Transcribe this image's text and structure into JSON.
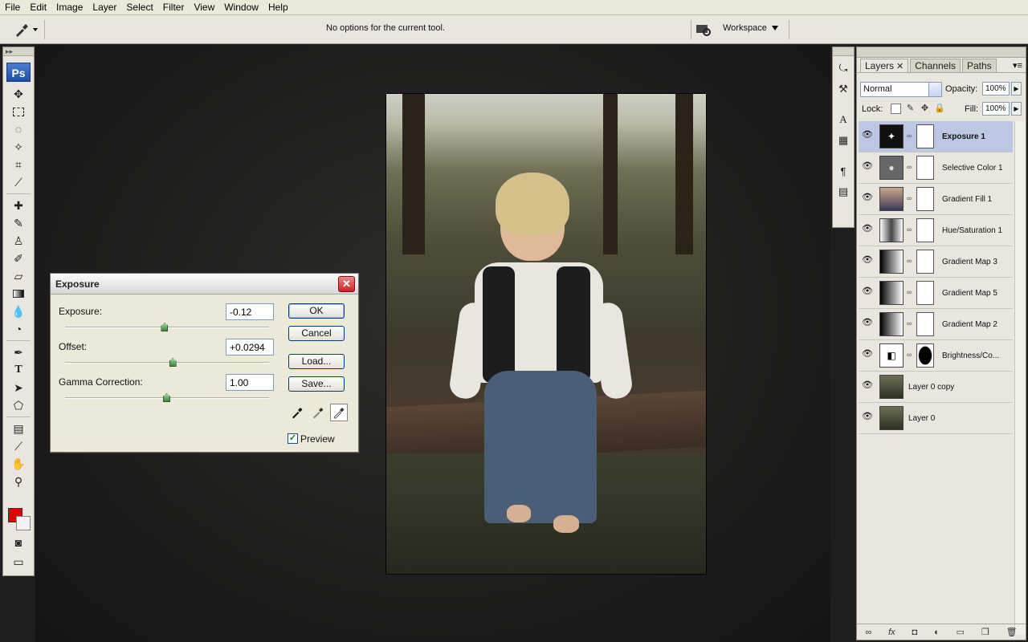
{
  "menu": [
    "File",
    "Edit",
    "Image",
    "Layer",
    "Select",
    "Filter",
    "View",
    "Window",
    "Help"
  ],
  "options_bar": {
    "message": "No options for the current tool.",
    "workspace_label": "Workspace"
  },
  "toolbox": {
    "logo": "Ps",
    "tools": [
      "move-tool",
      "marquee-tool",
      "lasso-tool",
      "magic-wand-tool",
      "crop-tool",
      "slice-tool",
      "healing-brush-tool",
      "brush-tool",
      "clone-stamp-tool",
      "history-brush-tool",
      "eraser-tool",
      "gradient-tool",
      "blur-tool",
      "dodge-tool",
      "pen-tool",
      "type-tool",
      "path-selection-tool",
      "shape-tool",
      "notes-tool",
      "eyedropper-tool",
      "hand-tool",
      "zoom-tool"
    ],
    "foreground_color": "#e00000",
    "background_color": "#f2f2f2"
  },
  "exposure_dialog": {
    "title": "Exposure",
    "exposure_label": "Exposure:",
    "exposure_value": "-0.12",
    "exposure_slider_level": 0.49,
    "offset_label": "Offset:",
    "offset_value": "+0.0294",
    "offset_slider_level": 0.53,
    "gamma_label": "Gamma Correction:",
    "gamma_value": "1.00",
    "gamma_slider_level": 0.5,
    "ok_label": "OK",
    "cancel_label": "Cancel",
    "load_label": "Load...",
    "save_label": "Save...",
    "preview_label": "Preview",
    "preview_checked": true
  },
  "layers_panel": {
    "tabs": [
      "Layers",
      "Channels",
      "Paths"
    ],
    "blend_mode": "Normal",
    "opacity_label": "Opacity:",
    "opacity_value": "100%",
    "lock_label": "Lock:",
    "fill_label": "Fill:",
    "fill_value": "100%",
    "layers": [
      {
        "name": "Exposure 1",
        "selected": true,
        "thumb": "exposure-icon"
      },
      {
        "name": "Selective Color 1",
        "selected": false,
        "thumb": "selective-color-icon"
      },
      {
        "name": "Gradient Fill 1",
        "selected": false,
        "thumb": "gradient-fill-icon"
      },
      {
        "name": "Hue/Saturation 1",
        "selected": false,
        "thumb": "hue-saturation-icon"
      },
      {
        "name": "Gradient Map 3",
        "selected": false,
        "thumb": "gradient-map-icon"
      },
      {
        "name": "Gradient Map 5",
        "selected": false,
        "thumb": "gradient-map-icon"
      },
      {
        "name": "Gradient Map 2",
        "selected": false,
        "thumb": "gradient-map-icon"
      },
      {
        "name": "Brightness/Co...",
        "selected": false,
        "thumb": "brightness-contrast-icon"
      },
      {
        "name": "Layer 0 copy",
        "selected": false,
        "thumb": "photo-thumbnail"
      },
      {
        "name": "Layer 0",
        "selected": false,
        "thumb": "photo-thumbnail"
      }
    ]
  }
}
